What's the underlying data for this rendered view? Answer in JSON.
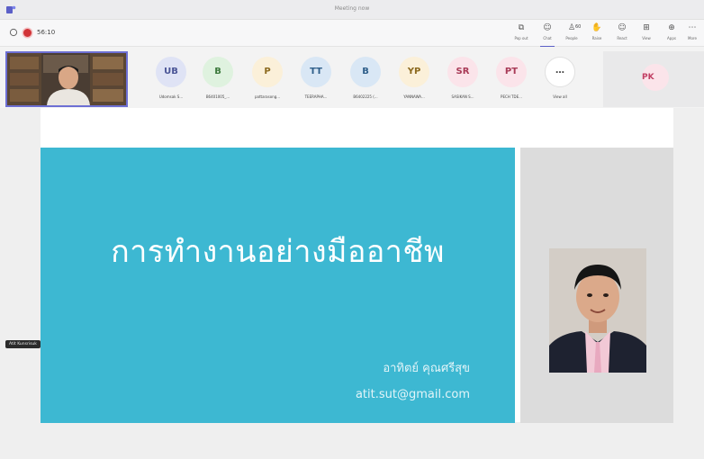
{
  "window": {
    "title": "Meeting now"
  },
  "toolbar": {
    "timer": "56:10",
    "buttons": [
      {
        "icon": "popout-icon",
        "label": "Pop out"
      },
      {
        "icon": "chat-icon",
        "label": "Chat"
      },
      {
        "icon": "people-icon",
        "label": "People",
        "count": "60"
      },
      {
        "icon": "raise-hand-icon",
        "label": "Raise"
      },
      {
        "icon": "react-icon",
        "label": "React"
      },
      {
        "icon": "view-icon",
        "label": "View"
      },
      {
        "icon": "apps-icon",
        "label": "Apps"
      },
      {
        "icon": "more-icon",
        "label": "More"
      }
    ],
    "active_button": "Chat"
  },
  "participants": [
    {
      "initials": "UB",
      "name": "Udomsak S...",
      "bg": "#dfe3f5",
      "fg": "#4a5596"
    },
    {
      "initials": "B",
      "name": "B6401005_...",
      "bg": "#dff2df",
      "fg": "#3d7a3d"
    },
    {
      "initials": "P",
      "name": "pattarasong...",
      "bg": "#fbf0d9",
      "fg": "#8c6a1f"
    },
    {
      "initials": "TT",
      "name": "TEERAPHA...",
      "bg": "#d9e7f5",
      "fg": "#2f5f8a"
    },
    {
      "initials": "B",
      "name": "B6402225 (...",
      "bg": "#d9e7f5",
      "fg": "#2f5f8a"
    },
    {
      "initials": "YP",
      "name": "YANNAWA...",
      "bg": "#fbf0d9",
      "fg": "#8c6a1f"
    },
    {
      "initials": "SR",
      "name": "SASIKAN S...",
      "bg": "#fbe4ea",
      "fg": "#a83a56"
    },
    {
      "initials": "PT",
      "name": "PECH TDE...",
      "bg": "#fbe4ea",
      "fg": "#a83a56"
    }
  ],
  "view_all": {
    "icon": "…",
    "label": "View all"
  },
  "pinned": {
    "initials": "PK"
  },
  "slide": {
    "title": "การทำงานอย่างมืออาชีพ",
    "presenter": "อาทิตย์ คุณศรีสุข",
    "email": "atit.sut@gmail.com"
  },
  "presenter_badge": "Atit Kunsrisuk",
  "colors": {
    "slide_teal": "#3db8d2",
    "accent": "#5b5fc7",
    "record": "#d13438"
  }
}
